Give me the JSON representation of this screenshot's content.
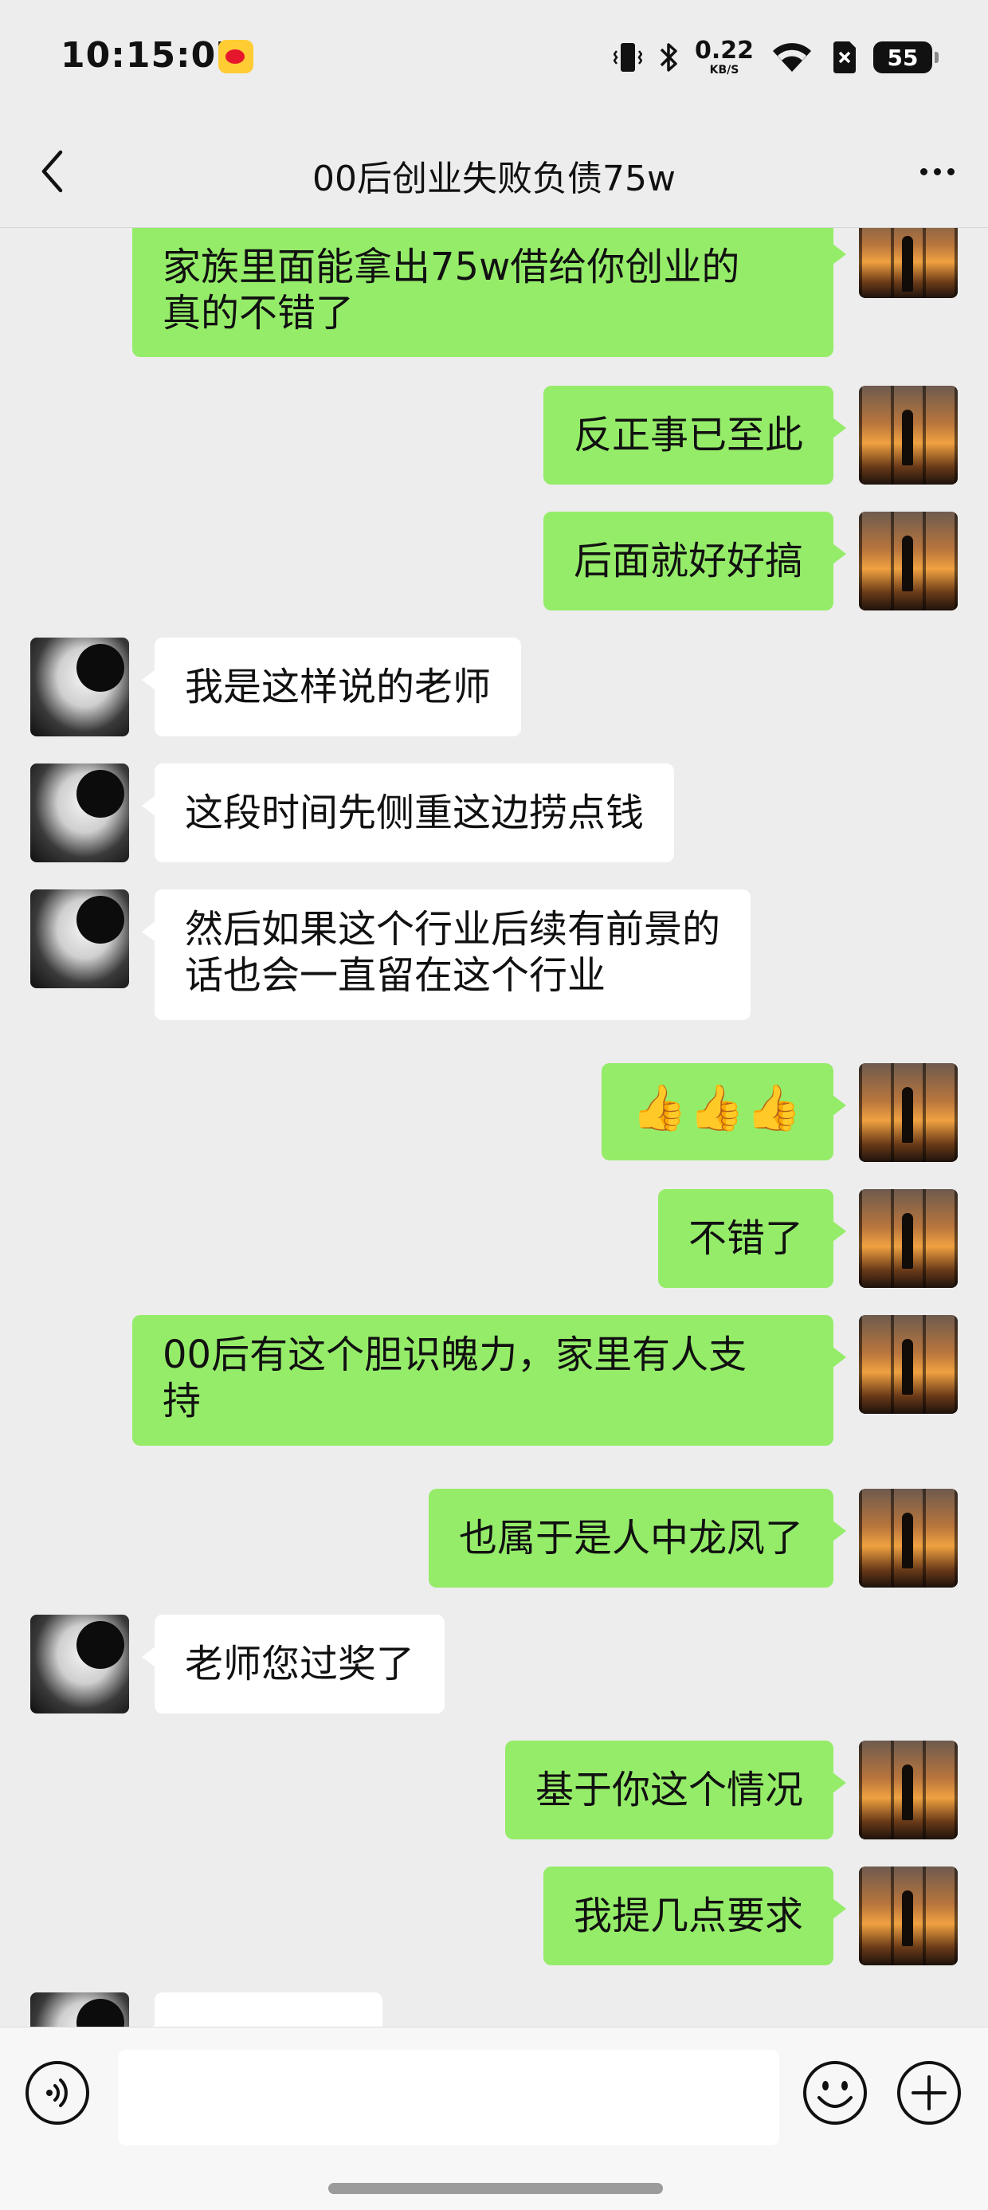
{
  "status_bar": {
    "time": "10:15:07",
    "net_speed_value": "0.22",
    "net_speed_unit": "KB/S",
    "battery_level": "55",
    "icons": [
      "weibo-icon",
      "vibrate-icon",
      "bluetooth-icon",
      "wifi-icon",
      "no-sim-icon",
      "battery-icon"
    ]
  },
  "header": {
    "title": "00后创业失败负债75w",
    "back_icon": "chevron-left-icon",
    "more_icon": "more-dots-icon"
  },
  "messages": [
    {
      "sender": "me",
      "lines": [
        "家族里面能拿出75w借给你创业的",
        "真的不错了"
      ]
    },
    {
      "sender": "me",
      "lines": [
        "反正事已至此"
      ]
    },
    {
      "sender": "me",
      "lines": [
        "后面就好好搞"
      ]
    },
    {
      "sender": "them",
      "lines": [
        "我是这样说的老师"
      ]
    },
    {
      "sender": "them",
      "lines": [
        "这段时间先侧重这边捞点钱"
      ]
    },
    {
      "sender": "them",
      "lines": [
        "然后如果这个行业后续有前景的",
        "话也会一直留在这个行业"
      ]
    },
    {
      "sender": "me",
      "lines": [
        "👍👍👍"
      ]
    },
    {
      "sender": "me",
      "lines": [
        "不错了"
      ]
    },
    {
      "sender": "me",
      "lines": [
        "00后有这个胆识魄力，家里有人支",
        "持"
      ]
    },
    {
      "sender": "me",
      "lines": [
        "也属于是人中龙凤了"
      ]
    },
    {
      "sender": "them",
      "lines": [
        "老师您过奖了"
      ]
    },
    {
      "sender": "me",
      "lines": [
        "基于你这个情况"
      ]
    },
    {
      "sender": "me",
      "lines": [
        "我提几点要求"
      ]
    }
  ],
  "input_bar": {
    "value": "",
    "placeholder": "",
    "voice_icon": "voice-icon",
    "emoji_icon": "emoji-icon",
    "plus_icon": "plus-icon"
  },
  "colors": {
    "background": "#ededed",
    "my_bubble": "#95ec69",
    "their_bubble": "#ffffff"
  }
}
